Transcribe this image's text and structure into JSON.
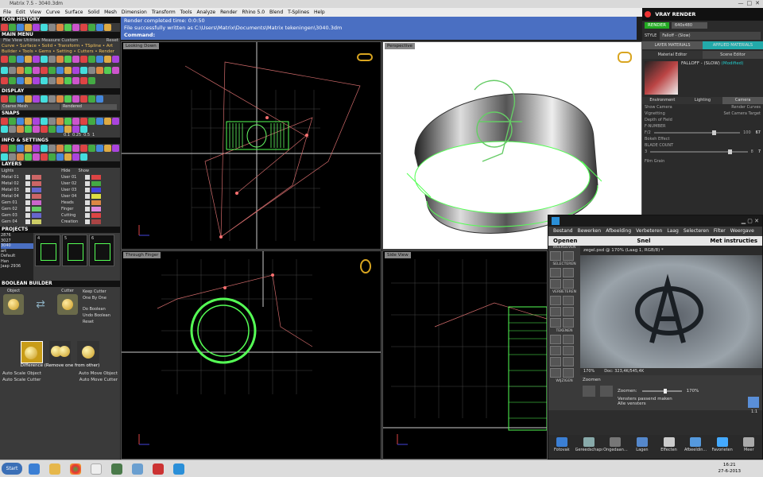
{
  "window": {
    "title": "Matrix 7.5 - 3040.3dm"
  },
  "menubar": [
    "File",
    "Edit",
    "View",
    "Curve",
    "Surface",
    "Solid",
    "Mesh",
    "Dimension",
    "Transform",
    "Tools",
    "Analyze",
    "Render",
    "Rhino 5.0",
    "Blend",
    "T-Splines",
    "Help"
  ],
  "left": {
    "icon_history": "ICON HISTORY",
    "main_menu": "MAIN MENU",
    "main_menu_sub": "File   View   Utilities   Measure   Custom",
    "reset": "Reset",
    "menu_row1": "Curve • Surface • Solid • Transform • TSpline • Art",
    "menu_row2": "Builder • Tools • Gems • Setting • Cutters • Render",
    "display": "DISPLAY",
    "display_mode": "Coarse Mesh",
    "display_mode2": "Rendered",
    "snaps": "SNAPS",
    "snap_values": [
      "0.1",
      "0.25",
      "0.5",
      "1"
    ],
    "info": "INFO & SETTINGS",
    "layers": "LAYERS",
    "layers_lights": "Lights",
    "layers_hide": "Hide",
    "layers_show": "Show",
    "layers_left": [
      "Metal 01",
      "Metal 02",
      "Metal 03",
      "Metal 04",
      "Gem 01",
      "Gem 02",
      "Gem 03",
      "Gem 04"
    ],
    "layers_right": [
      "User 01",
      "User 02",
      "User 03",
      "User 04",
      "Heads",
      "Finger",
      "Cutting",
      "Creation"
    ],
    "projects": "PROJECTS",
    "project_list": [
      "2876",
      "3027",
      "3040",
      "art",
      "Default",
      "Han",
      "Jaap 2936"
    ],
    "project_counts": [
      "4",
      "5",
      "6"
    ],
    "project_merge": "Merge",
    "boolean": "BOOLEAN BUILDER",
    "object": "Object",
    "cutter": "Cutter",
    "keep_cutter": "Keep Cutter",
    "one_by_one": "One By One",
    "do_boolean": "Do Boolean",
    "undo_boolean": "Undo Boolean",
    "reset2": "Reset",
    "difference": "Difference (Remove one from other)",
    "auto_scale_object": "Auto Scale Object",
    "auto_move_object": "Auto Move Object",
    "auto_scale_cutter": "Auto Scale Cutter",
    "auto_move_cutter": "Auto Move Cutter"
  },
  "command": {
    "line1": "Render completed time: 0:0:50",
    "line2": "File successfully written as C:\\Users\\Matrix\\Documents\\Matrix tekeningen\\3040.3dm",
    "line3": "Command:"
  },
  "viewports": [
    "Looking Down",
    "Perspective",
    "Through Finger",
    "Side View"
  ],
  "vray": {
    "title": "VRAY RENDER",
    "render": "RENDER",
    "size": "640x480",
    "style_label": "STYLE",
    "style": "Falloff - (Slow)",
    "tab1": "LAYER MATERIALS",
    "tab2": "APPLIED MATERIALS",
    "mat_editor": "Material Editor",
    "scene_editor": "Scene Editor",
    "mat_name": "FALLOFF - (SLOW)",
    "mat_modified": "(Modified)",
    "tab_env": "Environment",
    "tab_light": "Lighting",
    "tab_camera": "Camera",
    "show_camera": "Show Camera",
    "render_curves": "Render Curves",
    "vignetting": "Vignetting",
    "set_camera_target": "Set Camera Target",
    "dof": "Depth of Field",
    "fnumber": "F-NUMBER",
    "f_label": "F/",
    "f_min": "2",
    "f_max": "100",
    "f_val": "67",
    "bokeh": "Bokeh Effect",
    "blade": "BLADE COUNT",
    "blade_min": "3",
    "blade_max": "8",
    "blade_val": "7",
    "film_grain": "Film Grain"
  },
  "pe": {
    "menu": [
      "Bestand",
      "Bewerken",
      "Afbeelding",
      "Verbeteren",
      "Laag",
      "Selecteren",
      "Filter",
      "Weergave"
    ],
    "mode": "Openen",
    "snel": "Snel",
    "tab": "Met instructies",
    "doc": "zegel.psd @ 170% (Laag 1, RGB/8) *",
    "weergeven": "WEERGEVEN",
    "selecteren": "SELECTEREN",
    "verbeteren": "VERBETEREN",
    "tekenen": "TEKENEN",
    "wijzigen": "WIJZIGEN",
    "zoom_status": "170%",
    "doc_status": "Doc: 323,4K/545,4K",
    "zoomen_title": "Zoomen",
    "zoomen_label": "Zoomen:",
    "zoom_val": "170%",
    "fit_windows": "Vensters passend maken",
    "all_windows": "Alle vensters",
    "one_to_one": "1:1",
    "actions": [
      "Fotovak",
      "Gereedschapsopties",
      "Ongedaan...",
      "Lagen",
      "Effecten",
      "Afbeeldin...",
      "Favorieten",
      "Meer"
    ]
  },
  "taskbar": {
    "start": "Start",
    "time": "16:21",
    "date": "27-6-2013"
  }
}
